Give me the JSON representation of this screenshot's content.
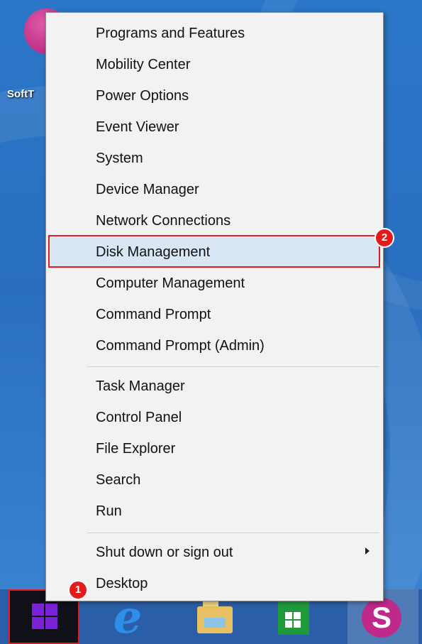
{
  "desktop": {
    "icon_label": "SoftT"
  },
  "menu": {
    "group1": [
      {
        "label": "Programs and Features"
      },
      {
        "label": "Mobility Center"
      },
      {
        "label": "Power Options"
      },
      {
        "label": "Event Viewer"
      },
      {
        "label": "System"
      },
      {
        "label": "Device Manager"
      },
      {
        "label": "Network Connections"
      },
      {
        "label": "Disk Management"
      },
      {
        "label": "Computer Management"
      },
      {
        "label": "Command Prompt"
      },
      {
        "label": "Command Prompt (Admin)"
      }
    ],
    "group2": [
      {
        "label": "Task Manager"
      },
      {
        "label": "Control Panel"
      },
      {
        "label": "File Explorer"
      },
      {
        "label": "Search"
      },
      {
        "label": "Run"
      }
    ],
    "group3": [
      {
        "label": "Shut down or sign out"
      },
      {
        "label": "Desktop"
      }
    ]
  },
  "annotations": {
    "badge_start": "1",
    "badge_disk": "2",
    "color": "#e51b1b"
  },
  "taskbar": {
    "ie_glyph": "e",
    "s_glyph": "S",
    "icons": [
      "windows-logo-icon",
      "internet-explorer-icon",
      "file-explorer-icon",
      "store-icon",
      "softtrade-icon"
    ]
  }
}
